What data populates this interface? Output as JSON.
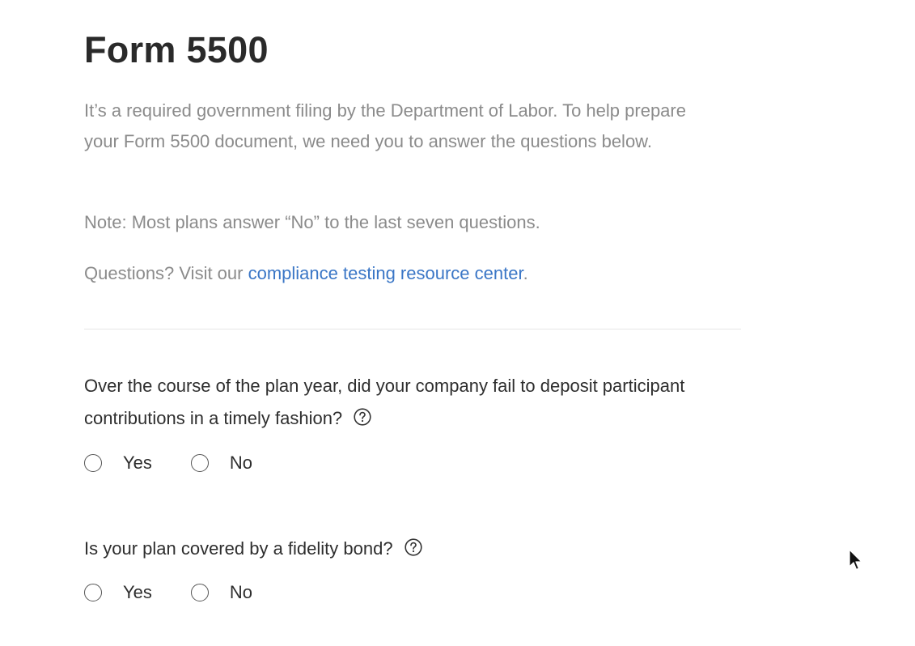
{
  "page": {
    "title": "Form 5500",
    "intro": "It’s a required government filing by the Department of Labor. To help prepare your Form 5500 document, we need you to answer the questions below.",
    "note": "Note: Most plans answer “No” to the last seven questions.",
    "help_prefix": "Questions? Visit our ",
    "help_link": "compliance testing resource center",
    "help_suffix": "."
  },
  "questions": [
    {
      "text": "Over the course of the plan year, did your company fail to deposit participant contributions in a timely fashion?",
      "options": [
        "Yes",
        "No"
      ],
      "selected": null
    },
    {
      "text": "Is your plan covered by a fidelity bond?",
      "options": [
        "Yes",
        "No"
      ],
      "selected": null
    }
  ],
  "icons": {
    "help": "question-circle-icon",
    "cursor": "mouse-pointer-icon"
  },
  "colors": {
    "link": "#3a76c6",
    "muted_text": "#8b8b8b",
    "body_text": "#2e2e2e"
  }
}
